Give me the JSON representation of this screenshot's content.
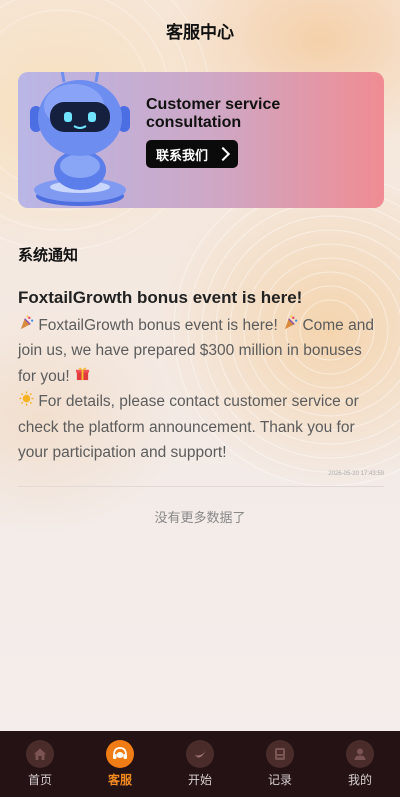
{
  "header": {
    "title": "客服中心"
  },
  "banner": {
    "title": "Customer service consultation",
    "contact_button": "联系我们"
  },
  "section": {
    "title": "系统通知"
  },
  "notice": {
    "title": "FoxtailGrowth bonus event is here!",
    "body_line1": "FoxtailGrowth bonus event is here!",
    "body_line2": "Come and join us, we have prepared $300 million in bonuses for you!",
    "body_line3": "For details, please contact customer service or check the platform announcement. Thank you for your participation and support!",
    "time": "2026-05-20 17:43:59"
  },
  "list": {
    "end_text": "没有更多数据了"
  },
  "tabbar": {
    "items": [
      {
        "label": "首页",
        "icon": "home-icon"
      },
      {
        "label": "客服",
        "icon": "customer-service-icon",
        "active": true
      },
      {
        "label": "开始",
        "icon": "start-icon"
      },
      {
        "label": "记录",
        "icon": "record-icon"
      },
      {
        "label": "我的",
        "icon": "profile-icon"
      }
    ]
  },
  "colors": {
    "accent": "#f07c15",
    "tabbar_bg": "#241214",
    "banner_gradient": [
      "#b9b6e6",
      "#f08c92"
    ]
  }
}
